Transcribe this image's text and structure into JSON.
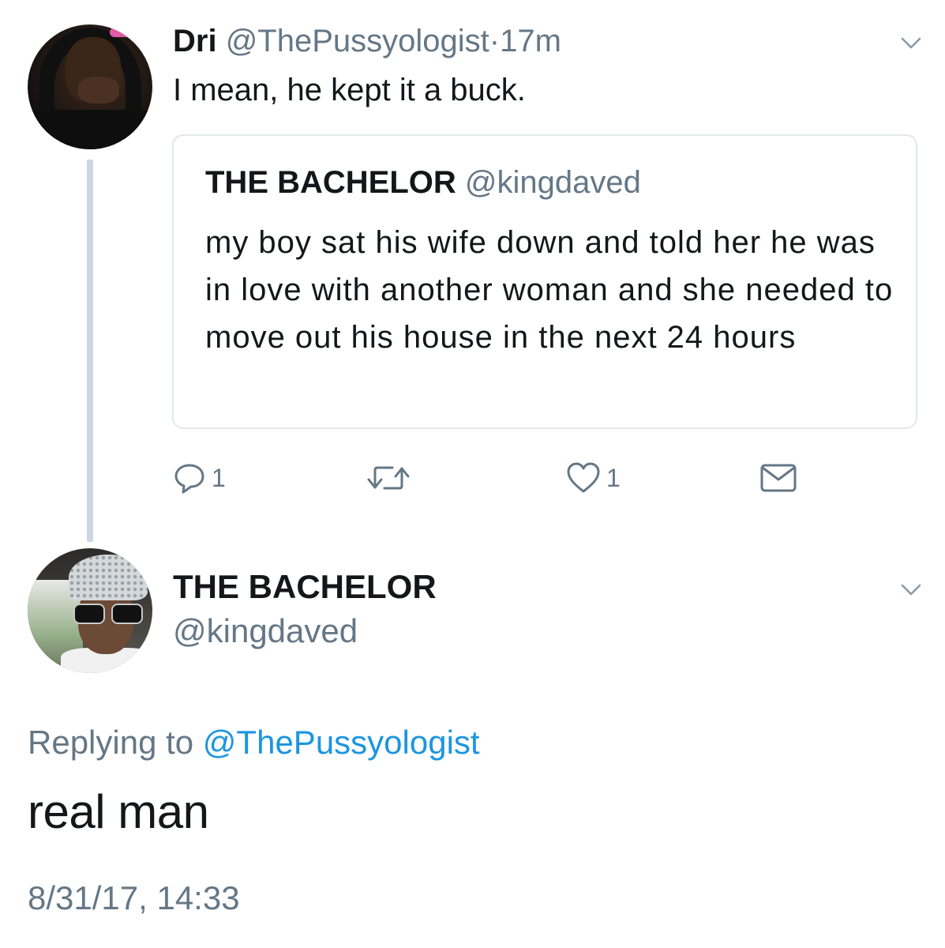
{
  "quote_tweet": {
    "author_name": "Dri",
    "author_handle": "@ThePussyologist",
    "separator": "·",
    "time": "17m",
    "text": "I mean, he kept it a buck.",
    "quoted": {
      "author_name": "THE BACHELOR",
      "author_handle": "@kingdaved",
      "text": "my boy sat his wife down and told her he was in love with another woman and she needed to move out his house in the next 24 hours"
    },
    "actions": {
      "reply_icon": "reply-icon",
      "reply_count": "1",
      "retweet_icon": "retweet-icon",
      "like_icon": "heart-icon",
      "like_count": "1",
      "dm_icon": "envelope-icon"
    }
  },
  "reply_tweet": {
    "author_name": "THE BACHELOR",
    "author_handle": "@kingdaved",
    "replying_label": "Replying to",
    "replying_mention": "@ThePussyologist",
    "text": "real man",
    "timestamp": "8/31/17, 14:33"
  },
  "colors": {
    "primary_text": "#14171a",
    "secondary_text": "#657786",
    "link": "#1b95e0",
    "border": "#e1e8ed",
    "thread_line": "#cbd6e2"
  }
}
